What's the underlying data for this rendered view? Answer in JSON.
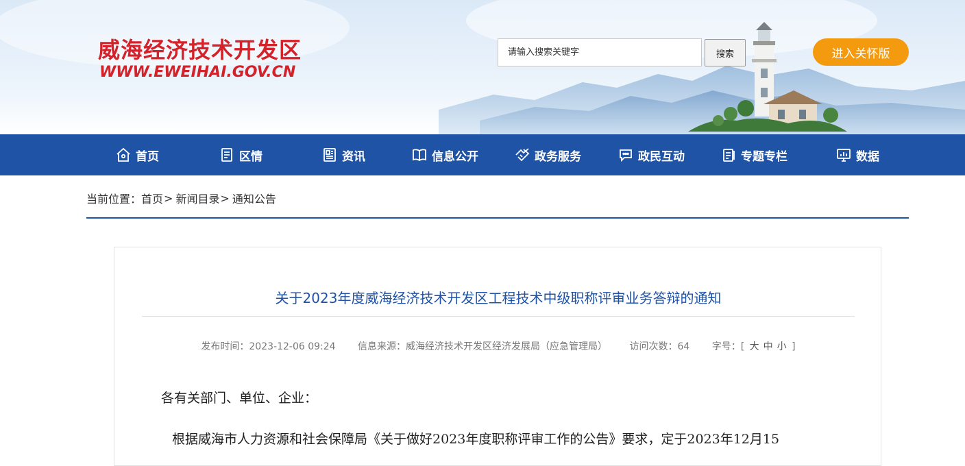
{
  "header": {
    "site_title": "威海经济技术开发区",
    "site_url": "WWW.EWEIHAI.GOV.CN",
    "search_placeholder": "请输入搜索关键字",
    "search_button": "搜索",
    "care_mode_button": "进入关怀版"
  },
  "nav": {
    "items": [
      {
        "label": "首页",
        "icon": "home-icon"
      },
      {
        "label": "区情",
        "icon": "document-icon"
      },
      {
        "label": "资讯",
        "icon": "newspaper-icon"
      },
      {
        "label": "信息公开",
        "icon": "book-icon"
      },
      {
        "label": "政务服务",
        "icon": "handshake-icon"
      },
      {
        "label": "政民互动",
        "icon": "chat-icon"
      },
      {
        "label": "专题专栏",
        "icon": "clipboard-icon"
      },
      {
        "label": "数据",
        "icon": "bar-chart-icon"
      }
    ]
  },
  "breadcrumb": {
    "prefix": "当前位置：",
    "items": [
      "首页",
      "新闻目录",
      "通知公告"
    ],
    "separator": ">"
  },
  "article": {
    "title": "关于2023年度威海经济技术开发区工程技术中级职称评审业务答辩的通知",
    "publish_time_label": "发布时间：",
    "publish_time": "2023-12-06 09:24",
    "source_label": "信息来源：",
    "source": "威海经济技术开发区经济发展局（应急管理局）",
    "visits_label": "访问次数：",
    "visits": "64",
    "font_size_label": "字号：",
    "font_size_open": "[",
    "font_size_large": "大",
    "font_size_medium": "中",
    "font_size_small": "小",
    "font_size_close": "]",
    "salutation": "各有关部门、单位、企业：",
    "paragraph_1": "根据威海市人力资源和社会保障局《关于做好2023年度职称评审工作的公告》要求，定于2023年12月15"
  },
  "colors": {
    "brand_red": "#d3222a",
    "nav_blue": "#1f53a5",
    "care_orange": "#f39a0e"
  }
}
